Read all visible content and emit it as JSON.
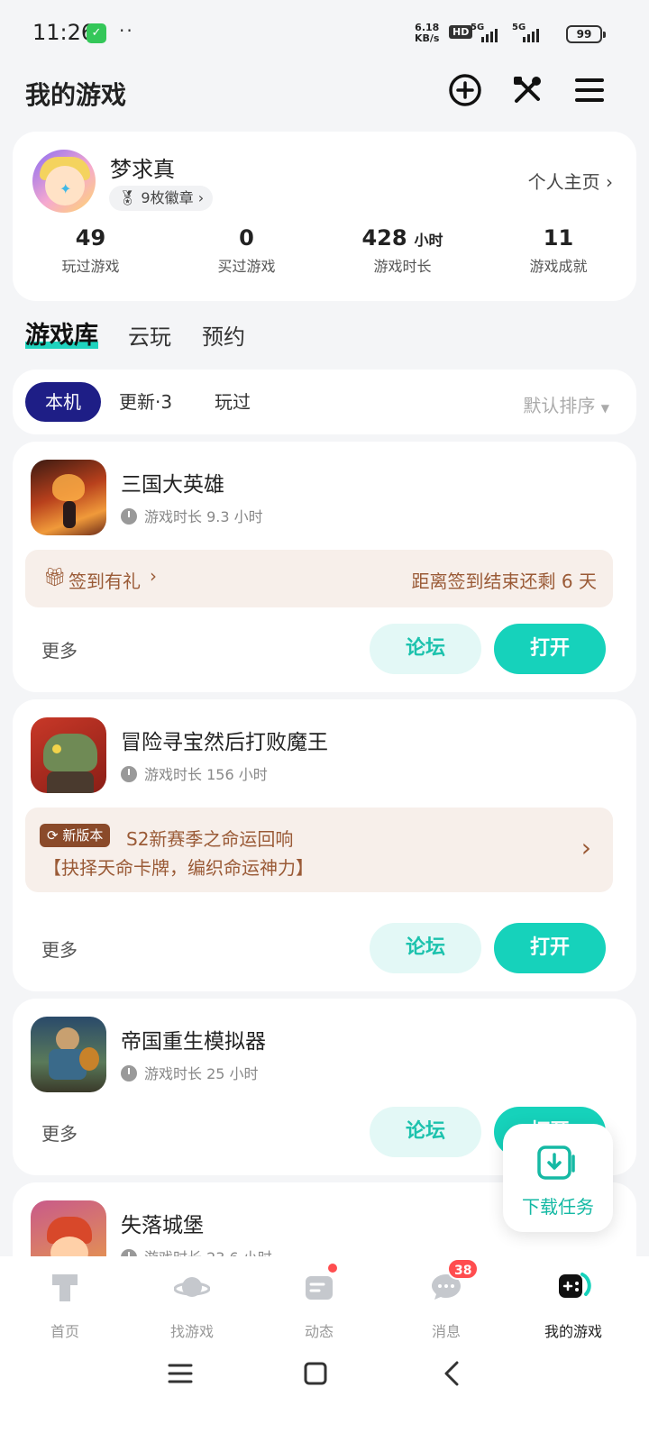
{
  "status_bar": {
    "time": "11:26",
    "net_speed_value": "6.18",
    "net_speed_unit": "KB/s",
    "hd": "HD",
    "net1": "5G",
    "net2": "5G",
    "battery": "99"
  },
  "header": {
    "title": "我的游戏",
    "icons": [
      "add-circle-icon",
      "tools-icon",
      "menu-icon"
    ]
  },
  "profile": {
    "name": "梦求真",
    "badges": "9枚徽章",
    "home_link": "个人主页",
    "stats": [
      {
        "value": "49",
        "unit": "",
        "label": "玩过游戏"
      },
      {
        "value": "0",
        "unit": "",
        "label": "买过游戏"
      },
      {
        "value": "428",
        "unit": "小时",
        "label": "游戏时长"
      },
      {
        "value": "11",
        "unit": "",
        "label": "游戏成就"
      }
    ]
  },
  "library_tabs": [
    "游戏库",
    "云玩",
    "预约"
  ],
  "filters": {
    "chips": [
      "本机",
      "更新·3",
      "玩过"
    ],
    "sort": "默认排序"
  },
  "games": [
    {
      "name": "三国大英雄",
      "playtime": "游戏时长 9.3 小时",
      "banner_left": "签到有礼",
      "banner_right": "距离签到结束还剩 6 天",
      "more": "更多",
      "forum": "论坛",
      "open": "打开"
    },
    {
      "name": "冒险寻宝然后打败魔王",
      "playtime": "游戏时长 156 小时",
      "tag": "新版本",
      "banner_line1": "S2新赛季之命运回响",
      "banner_line2": "【抉择天命卡牌，编织命运神力】",
      "more": "更多",
      "forum": "论坛",
      "open": "打开"
    },
    {
      "name": "帝国重生模拟器",
      "playtime": "游戏时长 25 小时",
      "more": "更多",
      "forum": "论坛",
      "open": "打开"
    },
    {
      "name": "失落城堡",
      "playtime": "游戏时长 23.6 小时"
    }
  ],
  "fab": {
    "label": "下载任务"
  },
  "bottom_nav": [
    {
      "label": "首页",
      "icon": "home-icon"
    },
    {
      "label": "找游戏",
      "icon": "planet-icon"
    },
    {
      "label": "动态",
      "icon": "feed-icon"
    },
    {
      "label": "消息",
      "icon": "message-icon",
      "badge": "38"
    },
    {
      "label": "我的游戏",
      "icon": "gamepad-icon"
    }
  ],
  "colors": {
    "accent": "#16d2bb",
    "active_chip": "#1e1e86",
    "banner_bg": "#f7efea",
    "banner_text": "#9a5a36",
    "badge_red": "#ff4d4f"
  }
}
